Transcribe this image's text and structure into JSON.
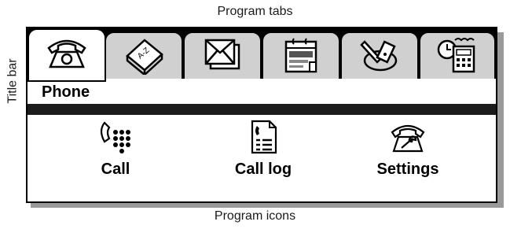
{
  "labels": {
    "program_tabs": "Program tabs",
    "title_bar": "Title bar",
    "program_icons": "Program icons"
  },
  "device": {
    "title": "Phone",
    "tabs": [
      {
        "icon": "phone-icon",
        "active": true
      },
      {
        "icon": "contacts-book-icon",
        "active": false
      },
      {
        "icon": "messages-icon",
        "active": false
      },
      {
        "icon": "calendar-icon",
        "active": false
      },
      {
        "icon": "tools-icon",
        "active": false
      },
      {
        "icon": "clock-calculator-icon",
        "active": false
      }
    ],
    "programs": [
      {
        "label": "Call",
        "icon": "call-keypad-icon"
      },
      {
        "label": "Call log",
        "icon": "call-log-icon"
      },
      {
        "label": "Settings",
        "icon": "phone-settings-icon"
      }
    ]
  }
}
